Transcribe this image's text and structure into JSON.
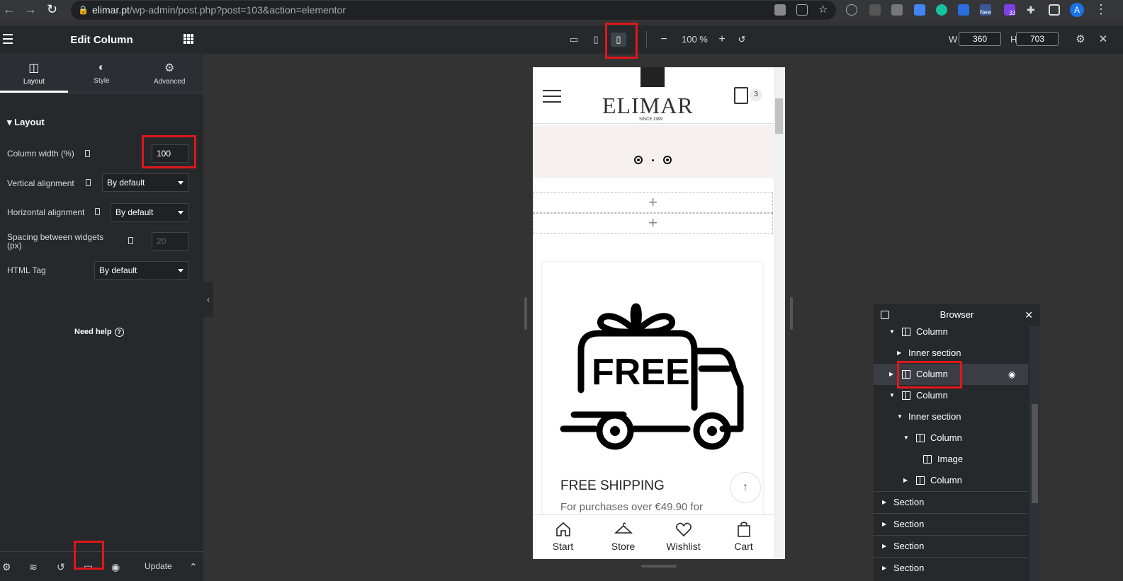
{
  "browser": {
    "url_host": "elimar.pt",
    "url_path": "/wp-admin/post.php?post=103&action=elementor",
    "ext_badge_new": "New",
    "ext_badge_count": "33",
    "profile_initial": "A"
  },
  "panel": {
    "title": "Edit Column",
    "tabs": [
      {
        "label": "Layout",
        "active": true
      },
      {
        "label": "Style"
      },
      {
        "label": "Advanced"
      }
    ],
    "section_title": "Layout",
    "controls": {
      "column_width_label": "Column width (%)",
      "column_width_value": "100",
      "vertical_alignment_label": "Vertical alignment",
      "vertical_alignment_value": "By default",
      "horizontal_alignment_label": "Horizontal alignment",
      "horizontal_alignment_value": "By default",
      "spacing_label_line1": "Spacing between widgets",
      "spacing_label_line2": "(px)",
      "spacing_placeholder": "20",
      "html_tag_label": "HTML Tag",
      "html_tag_value": "By default"
    },
    "need_help": "Need help",
    "footer": {
      "update_label": "Update"
    }
  },
  "topbar": {
    "zoom": "100 %",
    "width_label": "W",
    "width_value": "360",
    "height_label": "H",
    "height_value": "703"
  },
  "preview": {
    "logo": "ELIMAR",
    "since": "SINCE 1999",
    "cart_count": "3",
    "truck_text": "FREE",
    "card_title": "FREE SHIPPING",
    "card_subtitle": "For purchases over €49.90 for",
    "tabbar": [
      {
        "label": "Start",
        "icon": "home-icon"
      },
      {
        "label": "Store",
        "icon": "hanger-icon"
      },
      {
        "label": "Wishlist",
        "icon": "heart-icon"
      },
      {
        "label": "Cart",
        "icon": "bag-icon"
      }
    ]
  },
  "navigator": {
    "title": "Browser",
    "items": [
      {
        "label": "Column"
      },
      {
        "label": "Inner section"
      },
      {
        "label": "Column",
        "selected": true
      },
      {
        "label": "Column"
      },
      {
        "label": "Inner section"
      },
      {
        "label": "Column"
      },
      {
        "label": "Image"
      },
      {
        "label": "Column"
      },
      {
        "label": "Section"
      },
      {
        "label": "Section"
      },
      {
        "label": "Section"
      },
      {
        "label": "Section"
      }
    ]
  },
  "colors": {
    "highlight": "#e0161b",
    "panel_bg": "#26292c",
    "canvas_bg": "#333333"
  }
}
